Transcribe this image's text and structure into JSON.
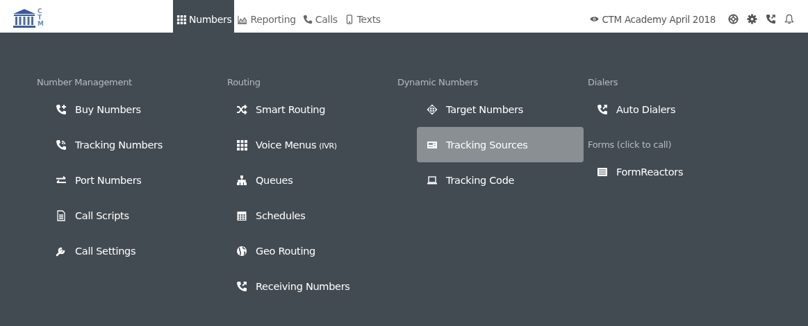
{
  "logo": {
    "letters": "CTM"
  },
  "nav": [
    {
      "label": "Numbers",
      "selected": true
    },
    {
      "label": "Reporting",
      "selected": false
    },
    {
      "label": "Calls",
      "selected": false
    },
    {
      "label": "Texts",
      "selected": false
    }
  ],
  "account": {
    "name": "CTM Academy April 2018"
  },
  "menu": {
    "columns": [
      {
        "sections": [
          {
            "heading": "Number Management",
            "items": [
              {
                "label": "Buy Numbers",
                "selected": false
              },
              {
                "label": "Tracking Numbers",
                "selected": false
              },
              {
                "label": "Port Numbers",
                "selected": false
              },
              {
                "label": "Call Scripts",
                "selected": false
              },
              {
                "label": "Call Settings",
                "selected": false
              }
            ]
          }
        ]
      },
      {
        "sections": [
          {
            "heading": "Routing",
            "items": [
              {
                "label": "Smart Routing",
                "selected": false
              },
              {
                "label": "Voice Menus",
                "suffix": "(IVR)",
                "selected": false
              },
              {
                "label": "Queues",
                "selected": false
              },
              {
                "label": "Schedules",
                "selected": false
              },
              {
                "label": "Geo Routing",
                "selected": false
              },
              {
                "label": "Receiving Numbers",
                "selected": false
              }
            ]
          }
        ]
      },
      {
        "sections": [
          {
            "heading": "Dynamic Numbers",
            "items": [
              {
                "label": "Target Numbers",
                "selected": false
              },
              {
                "label": "Tracking Sources",
                "selected": true
              },
              {
                "label": "Tracking Code",
                "selected": false
              }
            ]
          }
        ]
      },
      {
        "sections": [
          {
            "heading": "Dialers",
            "items": [
              {
                "label": "Auto Dialers",
                "selected": false
              }
            ]
          },
          {
            "heading": "Forms (click to call)",
            "items": [
              {
                "label": "FormReactors",
                "selected": false
              }
            ]
          }
        ]
      }
    ]
  }
}
